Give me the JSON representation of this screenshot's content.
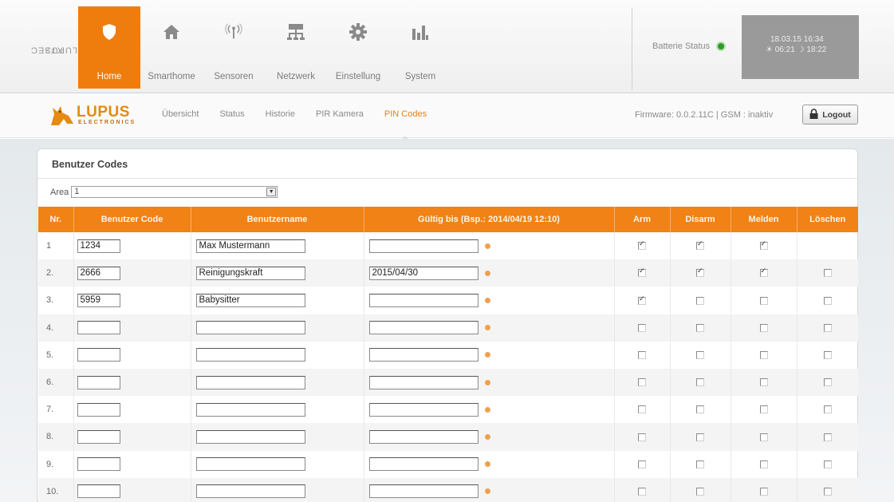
{
  "brand": {
    "vertical_line1": "LUPUSEC",
    "vertical_line2": "XT2"
  },
  "nav": [
    {
      "label": "Home",
      "icon": "shield-icon",
      "active": true
    },
    {
      "label": "Smarthome",
      "icon": "house-icon",
      "active": false
    },
    {
      "label": "Sensoren",
      "icon": "sensor-icon",
      "active": false
    },
    {
      "label": "Netzwerk",
      "icon": "network-icon",
      "active": false
    },
    {
      "label": "Einstellung",
      "icon": "gear-icon",
      "active": false
    },
    {
      "label": "System",
      "icon": "bar-chart-icon",
      "active": false
    }
  ],
  "status": {
    "battery_label": "Batterie Status",
    "battery_color": "#2e9a2a",
    "datetime": "18.03.15 16:34",
    "sunrise": "06:21",
    "sunset": "18:22"
  },
  "logo": {
    "text": "LUPUS",
    "subtext": "ELECTRONICS"
  },
  "subnav": [
    {
      "label": "Übersicht",
      "active": false
    },
    {
      "label": "Status",
      "active": false
    },
    {
      "label": "Historie",
      "active": false
    },
    {
      "label": "PIR Kamera",
      "active": false
    },
    {
      "label": "PIN Codes",
      "active": true
    }
  ],
  "firmware_text": "Firmware: 0.0.2.11C | GSM : inaktiv",
  "logout_label": "Logout",
  "panel": {
    "title": "Benutzer Codes",
    "area_label": "Area",
    "area_value": "1",
    "columns": [
      "Nr.",
      "Benutzer Code",
      "Benutzername",
      "Gültig bis (Bsp.: 2014/04/19 12:10)",
      "Arm",
      "Disarm",
      "Melden",
      "Löschen"
    ],
    "rows": [
      {
        "nr": "1",
        "code": "1234",
        "name": "Max Mustermann",
        "valid": "",
        "arm": true,
        "disarm": true,
        "melden": true,
        "loeschen": null
      },
      {
        "nr": "2.",
        "code": "2666",
        "name": "Reinigungskraft",
        "valid": "2015/04/30",
        "arm": true,
        "disarm": true,
        "melden": true,
        "loeschen": false
      },
      {
        "nr": "3.",
        "code": "5959",
        "name": "Babysitter",
        "valid": "",
        "arm": true,
        "disarm": false,
        "melden": false,
        "loeschen": false
      },
      {
        "nr": "4.",
        "code": "",
        "name": "",
        "valid": "",
        "arm": false,
        "disarm": false,
        "melden": false,
        "loeschen": false
      },
      {
        "nr": "5.",
        "code": "",
        "name": "",
        "valid": "",
        "arm": false,
        "disarm": false,
        "melden": false,
        "loeschen": false
      },
      {
        "nr": "6.",
        "code": "",
        "name": "",
        "valid": "",
        "arm": false,
        "disarm": false,
        "melden": false,
        "loeschen": false
      },
      {
        "nr": "7.",
        "code": "",
        "name": "",
        "valid": "",
        "arm": false,
        "disarm": false,
        "melden": false,
        "loeschen": false
      },
      {
        "nr": "8.",
        "code": "",
        "name": "",
        "valid": "",
        "arm": false,
        "disarm": false,
        "melden": false,
        "loeschen": false
      },
      {
        "nr": "9.",
        "code": "",
        "name": "",
        "valid": "",
        "arm": false,
        "disarm": false,
        "melden": false,
        "loeschen": false
      },
      {
        "nr": "10.",
        "code": "",
        "name": "",
        "valid": "",
        "arm": false,
        "disarm": false,
        "melden": false,
        "loeschen": false
      }
    ]
  },
  "colors": {
    "accent": "#ef7d0e",
    "header": "#f08216"
  }
}
